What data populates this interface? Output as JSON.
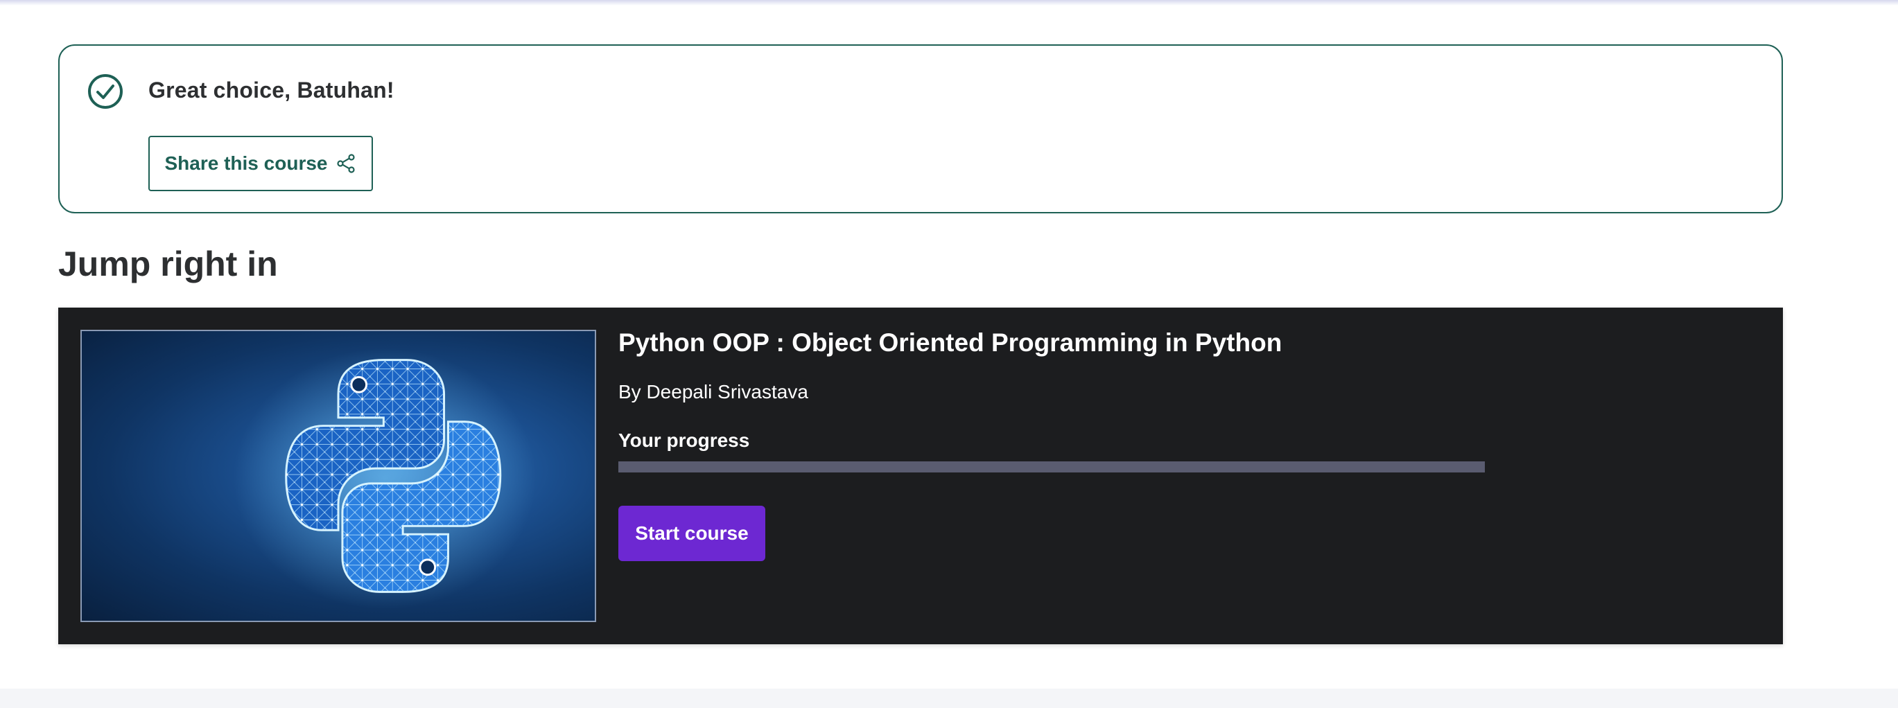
{
  "success": {
    "title": "Great choice, Batuhan!",
    "icon": "check-circle-icon",
    "share_button_label": "Share this course",
    "share_icon": "share-icon",
    "accent_color": "#1e6055"
  },
  "section": {
    "title": "Jump right in"
  },
  "course": {
    "title": "Python OOP : Object Oriented Programming in Python",
    "author": "By Deepali Srivastava",
    "thumbnail_icon": "python-logo-icon",
    "progress_label": "Your progress",
    "progress_fraction": 0,
    "start_button_label": "Start course",
    "start_button_color": "#6d28d2",
    "card_background": "#1c1d1f"
  }
}
